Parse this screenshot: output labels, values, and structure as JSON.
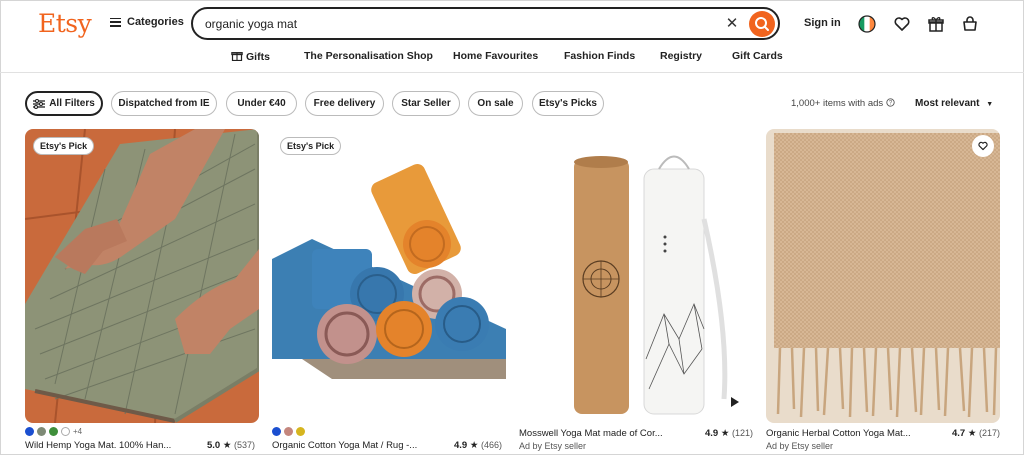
{
  "header": {
    "logo": "Etsy",
    "categories_label": "Categories",
    "search_value": "organic yoga mat",
    "signin_label": "Sign in"
  },
  "nav": [
    "Gifts",
    "The Personalisation Shop",
    "Home Favourites",
    "Fashion Finds",
    "Registry",
    "Gift Cards"
  ],
  "filters": {
    "chips": [
      "All Filters",
      "Dispatched from IE",
      "Under €40",
      "Free delivery",
      "Star Seller",
      "On sale",
      "Etsy's Picks"
    ],
    "results_text": "1,000+ items with ads",
    "sort_label": "Most relevant"
  },
  "listings": [
    {
      "badge": "Etsy's Pick",
      "title": "Wild Hemp Yoga Mat. 100% Han...",
      "rating": "5.0",
      "reviews": "(537)",
      "swatches": [
        "#1b4fd0",
        "#7e8a76",
        "#3f8f3b",
        "#ffffff"
      ],
      "more_colours": "+4"
    },
    {
      "badge": "Etsy's Pick",
      "title": "Organic Cotton Yoga Mat / Rug -...",
      "rating": "4.9",
      "reviews": "(466)",
      "swatches": [
        "#1b4fd0",
        "#c4867d",
        "#d6b51f"
      ]
    },
    {
      "title": "Mosswell Yoga Mat made of Cor...",
      "rating": "4.9",
      "reviews": "(121)",
      "ad_label": "Ad by Etsy seller"
    },
    {
      "title": "Organic Herbal Cotton Yoga Mat...",
      "rating": "4.7",
      "reviews": "(217)",
      "ad_label": "Ad by Etsy seller"
    }
  ],
  "colors": {
    "brand": "#f1641e"
  }
}
